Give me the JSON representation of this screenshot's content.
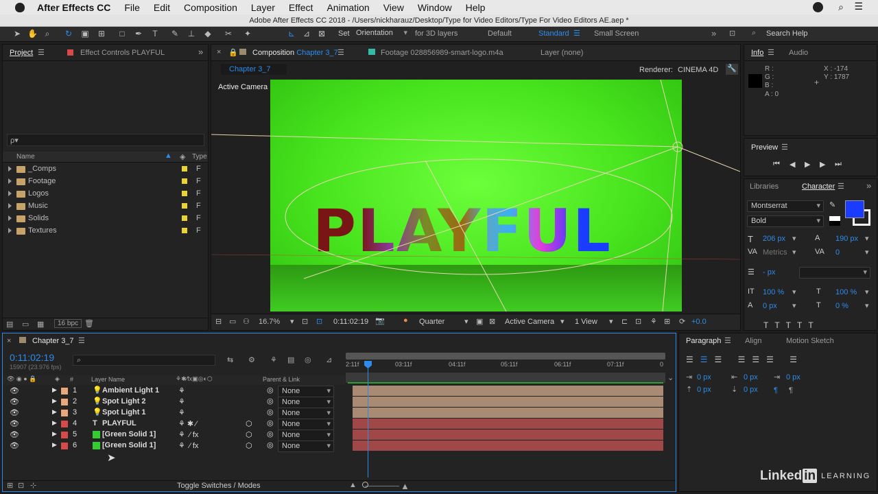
{
  "menubar": {
    "app": "After Effects CC",
    "items": [
      "File",
      "Edit",
      "Composition",
      "Layer",
      "Effect",
      "Animation",
      "View",
      "Window",
      "Help"
    ]
  },
  "title": "Adobe After Effects CC 2018 - /Users/nickharauz/Desktop/Type for Video Editors/Type For Video Editors AE.aep *",
  "toolbar": {
    "set": "Set",
    "orientation": "Orientation",
    "for3d": "for 3D layers",
    "workspaces": [
      "Default",
      "Standard",
      "Small Screen"
    ],
    "search": "Search Help"
  },
  "project": {
    "tab": "Project",
    "effect_tab": "Effect Controls PLAYFUL",
    "search_placeholder": "ρ▾",
    "col_name": "Name",
    "col_type": "Type",
    "items": [
      {
        "name": "_Comps",
        "type": "F"
      },
      {
        "name": "Footage",
        "type": "F"
      },
      {
        "name": "Logos",
        "type": "F"
      },
      {
        "name": "Music",
        "type": "F"
      },
      {
        "name": "Solids",
        "type": "F"
      },
      {
        "name": "Textures",
        "type": "F"
      }
    ],
    "bpc": "16 bpc"
  },
  "comp": {
    "tab_prefix": "Composition",
    "tab_name": "Chapter 3_7",
    "footage_tab": "Footage 028856989-smart-logo.m4a",
    "layer_tab": "Layer (none)",
    "breadcrumb": "Chapter 3_7",
    "renderer_label": "Renderer:",
    "renderer": "CINEMA 4D",
    "camera_label": "Active Camera",
    "viewport_text": "PLAYFUL",
    "zoom": "16.7%",
    "timecode": "0:11:02:19",
    "resolution": "Quarter",
    "view_camera": "Active Camera",
    "views": "1 View",
    "exposure": "+0.0"
  },
  "info": {
    "tab": "Info",
    "audio_tab": "Audio",
    "r": "R :",
    "g": "G :",
    "b": "B :",
    "a": "A : 0",
    "x": "X : -174",
    "y": "Y : 1787"
  },
  "preview": {
    "tab": "Preview"
  },
  "character": {
    "lib_tab": "Libraries",
    "tab": "Character",
    "font": "Montserrat",
    "style": "Bold",
    "size": "206 px",
    "leading": "190 px",
    "kerning": "Metrics",
    "tracking": "0",
    "stroke": "- px",
    "vscale": "100 %",
    "hscale": "100 %",
    "baseline": "0 px",
    "tsume": "0 %",
    "color_fill": "#1a3cff"
  },
  "timeline": {
    "tab": "Chapter 3_7",
    "timecode": "0:11:02:19",
    "frames": "15907 (23.976 fps)",
    "col_layer": "Layer Name",
    "col_parent": "Parent & Link",
    "ticks": [
      "2:11f",
      "03:11f",
      "04:11f",
      "05:11f",
      "06:11f",
      "07:11f",
      "0"
    ],
    "toggle": "Toggle Switches / Modes",
    "layers": [
      {
        "num": "1",
        "name": "Ambient Light 1",
        "label": "#e8a87a",
        "icon": "light",
        "parent": "None",
        "track": "#a98b73"
      },
      {
        "num": "2",
        "name": "Spot Light 2",
        "label": "#e8a87a",
        "icon": "light",
        "parent": "None",
        "track": "#a98b73"
      },
      {
        "num": "3",
        "name": "Spot Light 1",
        "label": "#e8a87a",
        "icon": "light",
        "parent": "None",
        "track": "#a98b73"
      },
      {
        "num": "4",
        "name": "PLAYFUL",
        "label": "#d84a4a",
        "icon": "T",
        "parent": "None",
        "track": "#a04848"
      },
      {
        "num": "5",
        "name": "[Green Solid 1]",
        "label": "#d84a4a",
        "icon": "solid",
        "parent": "None",
        "track": "#a04848"
      },
      {
        "num": "6",
        "name": "[Green Solid 1]",
        "label": "#d84a4a",
        "icon": "solid",
        "parent": "None",
        "track": "#a04848"
      }
    ]
  },
  "paragraph": {
    "tab": "Paragraph",
    "align_tab": "Align",
    "motion_tab": "Motion Sketch",
    "v1": "0 px",
    "v2": "0 px",
    "v3": "0 px",
    "v4": "0 px",
    "v5": "0 px"
  },
  "watermark": {
    "brand": "Linked",
    "in": "in",
    "learning": "LEARNING"
  }
}
